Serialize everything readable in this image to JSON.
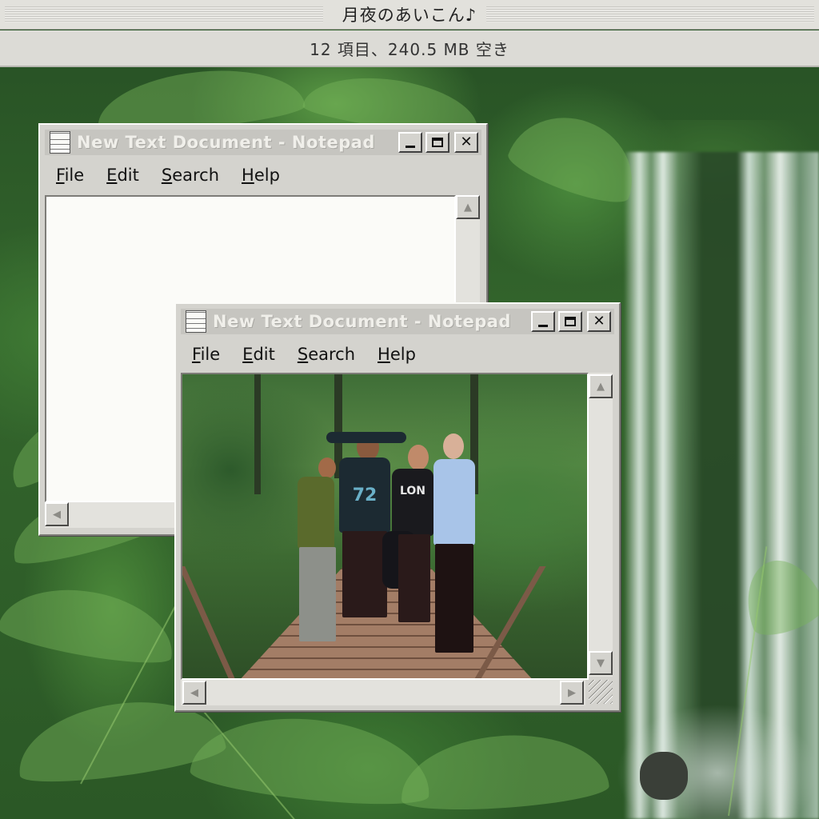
{
  "finder": {
    "title": "月夜のあいこん♪",
    "status": "12 項目、240.5 MB 空き"
  },
  "windows": [
    {
      "title": "New Text Document - Notepad",
      "menu": [
        {
          "label": "File",
          "accel": "F"
        },
        {
          "label": "Edit",
          "accel": "E"
        },
        {
          "label": "Search",
          "accel": "S"
        },
        {
          "label": "Help",
          "accel": "H"
        }
      ],
      "text": ""
    },
    {
      "title": "New Text Document - Notepad",
      "menu": [
        {
          "label": "File",
          "accel": "F"
        },
        {
          "label": "Edit",
          "accel": "E"
        },
        {
          "label": "Search",
          "accel": "S"
        },
        {
          "label": "Help",
          "accel": "H"
        }
      ]
    }
  ],
  "photo": {
    "jersey_number": "72",
    "shirt_text": "LON"
  },
  "colors": {
    "window_bg": "#d4d3ce",
    "title_text": "#f0efea",
    "foliage": "#2f5a2c"
  }
}
